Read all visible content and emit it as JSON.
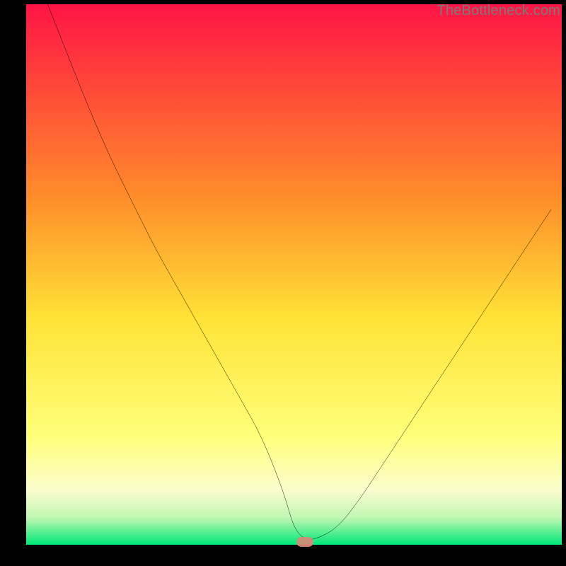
{
  "watermark": "TheBottleneck.com",
  "colors": {
    "top": "#ff1445",
    "mid_upper": "#ff8a2a",
    "mid": "#ffe236",
    "mid_lower": "#ffff7a",
    "pale": "#fafccd",
    "green_pale": "#c0f7b1",
    "green": "#00e878",
    "curve": "#000000",
    "marker": "#d98876",
    "background": "#000000"
  },
  "chart_data": {
    "type": "line",
    "title": "",
    "xlabel": "",
    "ylabel": "",
    "xlim": [
      0,
      100
    ],
    "ylim": [
      0,
      100
    ],
    "x": [
      4,
      8,
      12,
      16,
      20,
      24,
      28,
      32,
      36,
      40,
      44,
      48,
      50,
      52,
      54,
      58,
      62,
      66,
      70,
      74,
      78,
      82,
      86,
      90,
      94,
      98
    ],
    "values": [
      100,
      90,
      80,
      71,
      63,
      55,
      48,
      41,
      34,
      27,
      20,
      10,
      3,
      1,
      1,
      3,
      8,
      14,
      20,
      26,
      32,
      38,
      44,
      50,
      56,
      62
    ],
    "marker": {
      "x": 52,
      "y": 0.5
    },
    "annotations": []
  }
}
